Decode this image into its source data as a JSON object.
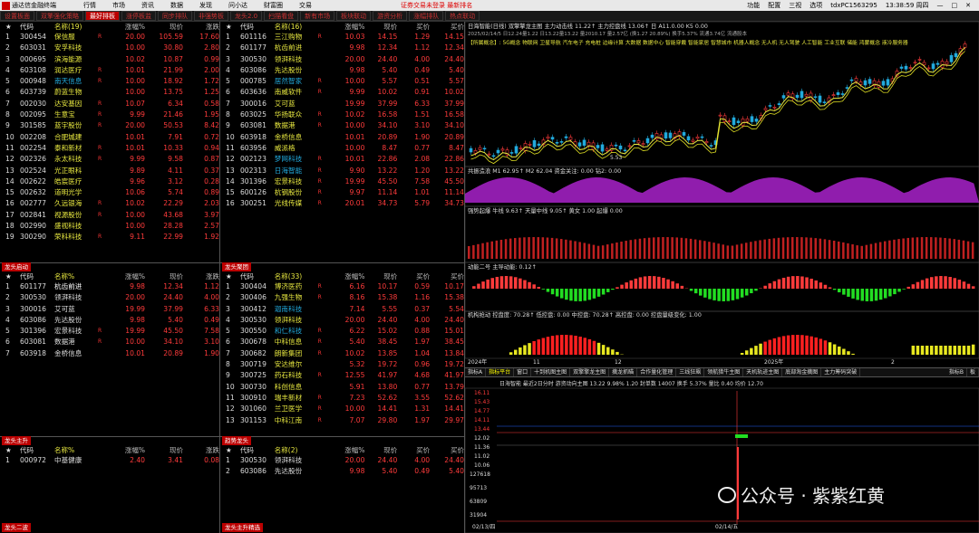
{
  "menubar": {
    "app_title": "通达信金融终端",
    "items": [
      "行情",
      "市场",
      "资讯",
      "数据",
      "发现",
      "问小达",
      "财富圈",
      "交易"
    ],
    "flash": "证券交易未登录  最新排名",
    "right": [
      "功能",
      "配置",
      "三视",
      "选项",
      "tdxPC1563295",
      "13:38:59 周四"
    ]
  },
  "tabs": [
    "设置板面",
    "双擎强化策略",
    "最好排板",
    "涨停板监",
    "同步排队",
    "非强势板",
    "龙头2.0",
    "扫描看盘",
    "新有市场",
    "板块联动",
    "游资分析",
    "涨幅排队",
    "热点联动"
  ],
  "headers": [
    "代码",
    "名称(19)",
    "涨幅%",
    "现价",
    "涨跌"
  ],
  "headers2": [
    "代码",
    "名称(16)",
    "涨幅%",
    "现价",
    "买价"
  ],
  "headers3": [
    "代码",
    "名称(33)",
    "涨幅%",
    "现价",
    "买价"
  ],
  "headers4": [
    "代码",
    "名称(2)",
    "涨幅%",
    "现价",
    "买价"
  ],
  "headers5": [
    "代码",
    "名称%",
    "涨幅%",
    "现价",
    "涨跌"
  ],
  "headers6": [
    "代码",
    "名称%",
    "涨幅%",
    "现价",
    "涨跌"
  ],
  "p1": [
    [
      "1",
      "300454",
      "保信服",
      "R",
      "20.00",
      "105.59",
      "17.60"
    ],
    [
      "2",
      "603031",
      "安孚科技",
      "",
      "10.00",
      "30.80",
      "2.80"
    ],
    [
      "3",
      "000695",
      "滨海能源",
      "",
      "10.02",
      "10.87",
      "0.99"
    ],
    [
      "4",
      "603108",
      "润达医疗",
      "R",
      "10.01",
      "21.99",
      "2.00"
    ],
    [
      "5",
      "000948",
      "南天信息",
      "R",
      "10.00",
      "18.92",
      "1.72"
    ],
    [
      "6",
      "603739",
      "蔚蓝生物",
      "",
      "10.00",
      "13.75",
      "1.25"
    ],
    [
      "7",
      "002030",
      "达安基因",
      "R",
      "10.07",
      "6.34",
      "0.58"
    ],
    [
      "8",
      "002095",
      "生意宝",
      "R",
      "9.99",
      "21.46",
      "1.95"
    ],
    [
      "9",
      "301585",
      "蓝宇股份",
      "R",
      "20.00",
      "50.53",
      "8.42"
    ],
    [
      "10",
      "002208",
      "合肥城建",
      "",
      "10.01",
      "7.91",
      "0.72"
    ],
    [
      "11",
      "002254",
      "泰和新材",
      "R",
      "10.01",
      "10.33",
      "0.94"
    ],
    [
      "12",
      "002326",
      "永太科技",
      "R",
      "9.99",
      "9.58",
      "0.87"
    ],
    [
      "13",
      "002524",
      "光正眼科",
      "",
      "9.89",
      "4.11",
      "0.37"
    ],
    [
      "14",
      "002622",
      "皓宸医疗",
      "",
      "9.96",
      "3.12",
      "0.28"
    ],
    [
      "15",
      "002632",
      "道明光学",
      "",
      "10.06",
      "5.74",
      "0.89"
    ],
    [
      "16",
      "002777",
      "久远银海",
      "R",
      "10.02",
      "22.29",
      "2.03"
    ],
    [
      "17",
      "002841",
      "视源股份",
      "R",
      "10.00",
      "43.68",
      "3.97"
    ],
    [
      "18",
      "002990",
      "盛视科技",
      "",
      "10.00",
      "28.28",
      "2.57"
    ],
    [
      "19",
      "300290",
      "荣科科技",
      "R",
      "9.11",
      "22.99",
      "1.92"
    ]
  ],
  "p2": [
    [
      "1",
      "601116",
      "三江购物",
      "R",
      "10.03",
      "14.15",
      "1.29",
      "14.15"
    ],
    [
      "2",
      "601177",
      "杭齿前进",
      "",
      "9.98",
      "12.34",
      "1.12",
      "12.34"
    ],
    [
      "3",
      "300530",
      "领湃科技",
      "",
      "20.00",
      "24.40",
      "4.00",
      "24.40"
    ],
    [
      "4",
      "603086",
      "先达股份",
      "",
      "9.98",
      "5.40",
      "0.49",
      "5.40"
    ],
    [
      "5",
      "000785",
      "居然智家",
      "R",
      "10.00",
      "5.57",
      "0.51",
      "5.57"
    ],
    [
      "6",
      "603636",
      "南威软件",
      "R",
      "9.99",
      "10.02",
      "0.91",
      "10.02"
    ],
    [
      "7",
      "300016",
      "艾可蓝",
      "",
      "19.99",
      "37.99",
      "6.33",
      "37.99"
    ],
    [
      "8",
      "603025",
      "华扬联众",
      "R",
      "10.02",
      "16.58",
      "1.51",
      "16.58"
    ],
    [
      "9",
      "603081",
      "数据港",
      "R",
      "10.00",
      "34.10",
      "3.10",
      "34.10"
    ],
    [
      "10",
      "603918",
      "金桥信息",
      "",
      "10.01",
      "20.89",
      "1.90",
      "20.89"
    ],
    [
      "11",
      "603956",
      "威派格",
      "",
      "10.00",
      "8.47",
      "0.77",
      "8.47"
    ],
    [
      "12",
      "002123",
      "梦网科技",
      "R",
      "10.01",
      "22.86",
      "2.08",
      "22.86"
    ],
    [
      "13",
      "002313",
      "日海智能",
      "R",
      "9.90",
      "13.22",
      "1.20",
      "13.22"
    ],
    [
      "14",
      "301396",
      "宏景科技",
      "R",
      "19.99",
      "45.50",
      "7.58",
      "45.50"
    ],
    [
      "15",
      "600126",
      "杭钢股份",
      "R",
      "9.97",
      "11.14",
      "1.01",
      "11.14"
    ],
    [
      "16",
      "300251",
      "光线传媒",
      "R",
      "20.01",
      "34.73",
      "5.79",
      "34.73"
    ]
  ],
  "p3": [
    [
      "1",
      "601177",
      "杭齿前进",
      "",
      "9.98",
      "12.34",
      "1.12"
    ],
    [
      "2",
      "300530",
      "领湃科技",
      "",
      "20.00",
      "24.40",
      "4.00"
    ],
    [
      "3",
      "300016",
      "艾可蓝",
      "",
      "19.99",
      "37.99",
      "6.33"
    ],
    [
      "4",
      "603086",
      "先达股份",
      "",
      "9.98",
      "5.40",
      "0.49"
    ],
    [
      "5",
      "301396",
      "宏景科技",
      "R",
      "19.99",
      "45.50",
      "7.58"
    ],
    [
      "6",
      "603081",
      "数据港",
      "R",
      "10.00",
      "34.10",
      "3.10"
    ],
    [
      "7",
      "603918",
      "金桥信息",
      "",
      "10.01",
      "20.89",
      "1.90"
    ]
  ],
  "p4": [
    [
      "1",
      "300404",
      "博济医药",
      "R",
      "6.16",
      "10.17",
      "0.59",
      "10.17"
    ],
    [
      "2",
      "300406",
      "九强生物",
      "R",
      "8.16",
      "15.38",
      "1.16",
      "15.38"
    ],
    [
      "3",
      "300412",
      "迦南科技",
      "",
      "7.14",
      "5.55",
      "0.37",
      "5.54"
    ],
    [
      "4",
      "300530",
      "领湃科技",
      "",
      "20.00",
      "24.40",
      "4.00",
      "24.40"
    ],
    [
      "5",
      "300550",
      "和仁科技",
      "R",
      "6.22",
      "15.02",
      "0.88",
      "15.01"
    ],
    [
      "6",
      "300678",
      "中科信息",
      "R",
      "5.40",
      "38.45",
      "1.97",
      "38.45"
    ],
    [
      "7",
      "300682",
      "朗新集团",
      "R",
      "10.02",
      "13.85",
      "1.04",
      "13.84"
    ],
    [
      "8",
      "300719",
      "安达维尔",
      "",
      "5.32",
      "19.72",
      "0.96",
      "19.72"
    ],
    [
      "9",
      "300725",
      "药石科技",
      "R",
      "12.55",
      "41.97",
      "4.68",
      "41.97"
    ],
    [
      "10",
      "300730",
      "科创信息",
      "",
      "5.91",
      "13.80",
      "0.77",
      "13.79"
    ],
    [
      "11",
      "300910",
      "瑞丰新材",
      "R",
      "7.23",
      "52.62",
      "3.55",
      "52.62"
    ],
    [
      "12",
      "301060",
      "兰卫医学",
      "R",
      "10.00",
      "14.41",
      "1.31",
      "14.41"
    ],
    [
      "13",
      "301153",
      "中科江南",
      "R",
      "7.07",
      "29.80",
      "1.97",
      "29.97"
    ]
  ],
  "p5": [
    [
      "1",
      "000972",
      "中基健康",
      "",
      "2.40",
      "3.41",
      "0.08"
    ]
  ],
  "p6": [
    [
      "1",
      "300530",
      "领湃科技",
      "",
      "20.00",
      "24.40",
      "4.00",
      "24.40"
    ],
    [
      "2",
      "603086",
      "先达股份",
      "",
      "9.98",
      "5.40",
      "0.49",
      "5.40"
    ]
  ],
  "labels": {
    "p3": "龙头启动",
    "p4": "龙头聚团",
    "p5": "龙头主升",
    "p6": "趋势龙头",
    "bl": "龙头二波",
    "bm": "龙头主升精选"
  },
  "chart": {
    "title": "日海智能(日线)  双擎擎龙主图  主力动击线 11.22↑  主力控盘线 13.06↑  日 A11.0.00  K5 0.00",
    "subtitle": "2025/02/14/5  日12.24量1.22  日13.22量13.22  量2010.17 量2.57亿  (换1.27 20.89%)  换手5.37%  流通3.74亿  流通股本",
    "sectors": "【所属概念】: 5G概念 物联网 卫星导航 汽车电子 充电桩 边缘计算 大数据 数据中心 智能穿戴 智能家居 智慧城市 机器人概念 无人机 无人驾驶 人工智能 工业互联 储能 鸿蒙概念 液冷服务器",
    "price_low": "5.53",
    "ind1": "共振造浪 M1 62.95↑  M2 62.04  资金关注: 0.00  钻2: 0.00",
    "ind2": "强势起爆  牛线 9.63↑  天量中线 9.05↑  黄女 1.00  起爆 0.00",
    "ind3": "动能二号  主导动能: 0.12↑",
    "ind4": "机构抢动  控盘度: 70.28↑  低控盘: 0.00  中控盘: 70.28↑  高控盘: 0.00  控盘量级变化: 1.00",
    "dates": [
      "2024年",
      "11",
      "12",
      "2025年",
      "2"
    ],
    "btabs": [
      "指标A",
      "指标平台",
      "窗口",
      "十到机图主图",
      "双擎擎龙主图",
      "擒龙抓瞄",
      "合作量化管理",
      "三线狂飙",
      "领航猎牛主图",
      "天机轨迹主图",
      "底部淘金擒图",
      "主力筹码突破"
    ],
    "btabs_right": [
      "指标B",
      "板"
    ],
    "intraday_title": "日海智能  最近2日分时 游资动向主图 13.22  9.98%  1.20  封单数 14007  换手 5.37%  量比 0.40  均价 12.70",
    "intraday_prices": [
      "16.11",
      "15.43",
      "14.77",
      "14.11",
      "13.44",
      "12.02",
      "11.36",
      "11.02",
      "10.06"
    ],
    "intraday_vols": [
      "127618",
      "95713",
      "63809",
      "31904"
    ],
    "intraday_dates": [
      "02/13/四",
      "02/14/五"
    ],
    "watermark": "公众号 · 紫紫红黄"
  }
}
